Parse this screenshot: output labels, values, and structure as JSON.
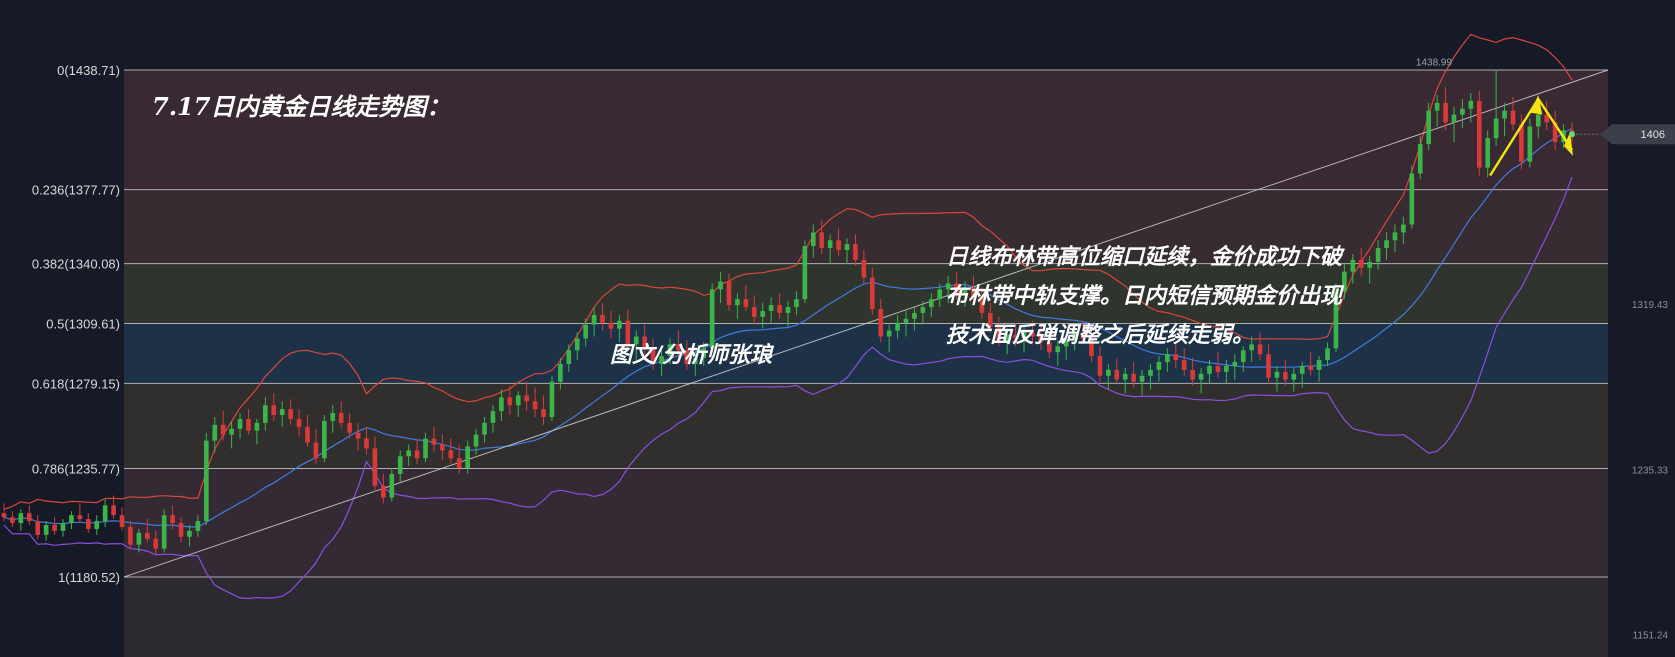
{
  "chart_data": {
    "type": "candlestick",
    "title": "7.17日内黄金日线走势图：",
    "author": "图文/分析师张琅",
    "annotation": [
      "日线布林带高位缩口延续，金价成功下破",
      "布林带中轨支撑。日内短信预期金价出现",
      "技术面反弹调整之后延续走弱。"
    ],
    "fib_levels": [
      {
        "ratio": "0",
        "price": 1438.71,
        "label": "0(1438.71)",
        "band_color": "#3b2a33"
      },
      {
        "ratio": "0.236",
        "price": 1377.77,
        "label": "0.236(1377.77)",
        "band_color": "#382d31"
      },
      {
        "ratio": "0.382",
        "price": 1340.08,
        "label": "0.382(1340.08)",
        "band_color": "#30362f"
      },
      {
        "ratio": "0.5",
        "price": 1309.61,
        "label": "0.5(1309.61)",
        "band_color": "#1e3349"
      },
      {
        "ratio": "0.618",
        "price": 1279.15,
        "label": "0.618(1279.15)",
        "band_color": "#33302d"
      },
      {
        "ratio": "0.786",
        "price": 1235.77,
        "label": "0.786(1235.77)",
        "band_color": "#362b35"
      },
      {
        "ratio": "1",
        "price": 1180.52,
        "label": "1(1180.52)",
        "band_color": "#2d2a31"
      }
    ],
    "price_axis_ticks": [
      "1319.43",
      "1235.33",
      "1151.24"
    ],
    "price_axis_ticks_values": [
      1319.43,
      1235.33,
      1151.24
    ],
    "high_label": "1438.99",
    "high_value": 1438.99,
    "current_price_label": "1406",
    "current_price": 1406,
    "candles": [
      [
        1213,
        1218,
        1209,
        1211
      ],
      [
        1211,
        1214,
        1206,
        1208
      ],
      [
        1208,
        1215,
        1204,
        1213
      ],
      [
        1213,
        1217,
        1207,
        1209
      ],
      [
        1209,
        1212,
        1200,
        1202
      ],
      [
        1202,
        1209,
        1199,
        1207
      ],
      [
        1207,
        1211,
        1202,
        1204
      ],
      [
        1204,
        1210,
        1201,
        1208
      ],
      [
        1208,
        1214,
        1205,
        1212
      ],
      [
        1212,
        1218,
        1208,
        1210
      ],
      [
        1210,
        1213,
        1203,
        1205
      ],
      [
        1205,
        1212,
        1202,
        1209
      ],
      [
        1209,
        1220,
        1206,
        1217
      ],
      [
        1217,
        1222,
        1210,
        1212
      ],
      [
        1212,
        1216,
        1204,
        1206
      ],
      [
        1206,
        1209,
        1195,
        1197
      ],
      [
        1197,
        1205,
        1193,
        1203
      ],
      [
        1203,
        1210,
        1198,
        1200
      ],
      [
        1200,
        1204,
        1192,
        1195
      ],
      [
        1195,
        1215,
        1193,
        1212
      ],
      [
        1212,
        1217,
        1205,
        1208
      ],
      [
        1208,
        1211,
        1198,
        1201
      ],
      [
        1201,
        1207,
        1196,
        1204
      ],
      [
        1204,
        1212,
        1201,
        1209
      ],
      [
        1209,
        1254,
        1207,
        1250
      ],
      [
        1250,
        1262,
        1244,
        1258
      ],
      [
        1258,
        1265,
        1250,
        1253
      ],
      [
        1253,
        1260,
        1246,
        1256
      ],
      [
        1256,
        1264,
        1251,
        1261
      ],
      [
        1261,
        1266,
        1253,
        1255
      ],
      [
        1255,
        1261,
        1248,
        1259
      ],
      [
        1259,
        1272,
        1255,
        1268
      ],
      [
        1268,
        1274,
        1260,
        1263
      ],
      [
        1263,
        1270,
        1257,
        1266
      ],
      [
        1266,
        1271,
        1258,
        1261
      ],
      [
        1261,
        1266,
        1252,
        1257
      ],
      [
        1257,
        1263,
        1247,
        1249
      ],
      [
        1249,
        1256,
        1238,
        1241
      ],
      [
        1241,
        1263,
        1239,
        1260
      ],
      [
        1260,
        1268,
        1254,
        1264
      ],
      [
        1264,
        1270,
        1256,
        1259
      ],
      [
        1259,
        1264,
        1251,
        1254
      ],
      [
        1254,
        1259,
        1245,
        1251
      ],
      [
        1251,
        1257,
        1243,
        1246
      ],
      [
        1246,
        1252,
        1224,
        1227
      ],
      [
        1227,
        1233,
        1218,
        1221
      ],
      [
        1221,
        1236,
        1219,
        1233
      ],
      [
        1233,
        1245,
        1229,
        1242
      ],
      [
        1242,
        1248,
        1237,
        1245
      ],
      [
        1245,
        1250,
        1238,
        1241
      ],
      [
        1241,
        1254,
        1239,
        1251
      ],
      [
        1251,
        1257,
        1244,
        1248
      ],
      [
        1248,
        1253,
        1240,
        1245
      ],
      [
        1245,
        1251,
        1238,
        1241
      ],
      [
        1241,
        1248,
        1233,
        1236
      ],
      [
        1236,
        1250,
        1233,
        1247
      ],
      [
        1247,
        1256,
        1243,
        1253
      ],
      [
        1253,
        1262,
        1249,
        1259
      ],
      [
        1259,
        1268,
        1254,
        1265
      ],
      [
        1265,
        1276,
        1260,
        1272
      ],
      [
        1272,
        1278,
        1263,
        1268
      ],
      [
        1268,
        1275,
        1262,
        1273
      ],
      [
        1273,
        1280,
        1265,
        1270
      ],
      [
        1270,
        1277,
        1262,
        1266
      ],
      [
        1266,
        1273,
        1258,
        1262
      ],
      [
        1262,
        1283,
        1260,
        1280
      ],
      [
        1280,
        1292,
        1276,
        1289
      ],
      [
        1289,
        1299,
        1285,
        1296
      ],
      [
        1296,
        1305,
        1291,
        1302
      ],
      [
        1302,
        1312,
        1298,
        1309
      ],
      [
        1309,
        1318,
        1303,
        1314
      ],
      [
        1314,
        1320,
        1306,
        1310
      ],
      [
        1310,
        1316,
        1302,
        1307
      ],
      [
        1307,
        1314,
        1300,
        1311
      ],
      [
        1311,
        1317,
        1296,
        1299
      ],
      [
        1299,
        1306,
        1291,
        1303
      ],
      [
        1303,
        1309,
        1294,
        1297
      ],
      [
        1297,
        1302,
        1286,
        1289
      ],
      [
        1289,
        1296,
        1283,
        1293
      ],
      [
        1293,
        1302,
        1289,
        1299
      ],
      [
        1299,
        1306,
        1292,
        1296
      ],
      [
        1296,
        1301,
        1286,
        1289
      ],
      [
        1289,
        1295,
        1283,
        1292
      ],
      [
        1292,
        1300,
        1288,
        1297
      ],
      [
        1297,
        1330,
        1295,
        1327
      ],
      [
        1327,
        1336,
        1320,
        1331
      ],
      [
        1331,
        1335,
        1316,
        1319
      ],
      [
        1319,
        1325,
        1312,
        1322
      ],
      [
        1322,
        1329,
        1316,
        1318
      ],
      [
        1318,
        1324,
        1309,
        1313
      ],
      [
        1313,
        1320,
        1307,
        1316
      ],
      [
        1316,
        1323,
        1310,
        1319
      ],
      [
        1319,
        1325,
        1312,
        1315
      ],
      [
        1315,
        1321,
        1308,
        1318
      ],
      [
        1318,
        1326,
        1314,
        1322
      ],
      [
        1322,
        1352,
        1320,
        1349
      ],
      [
        1349,
        1360,
        1343,
        1356
      ],
      [
        1356,
        1362,
        1345,
        1348
      ],
      [
        1348,
        1355,
        1340,
        1352
      ],
      [
        1352,
        1358,
        1344,
        1347
      ],
      [
        1347,
        1353,
        1340,
        1350
      ],
      [
        1350,
        1355,
        1339,
        1342
      ],
      [
        1342,
        1347,
        1330,
        1333
      ],
      [
        1333,
        1338,
        1314,
        1317
      ],
      [
        1317,
        1322,
        1300,
        1303
      ],
      [
        1303,
        1309,
        1295,
        1306
      ],
      [
        1306,
        1314,
        1302,
        1310
      ],
      [
        1310,
        1316,
        1303,
        1312
      ],
      [
        1312,
        1318,
        1306,
        1315
      ],
      [
        1315,
        1321,
        1309,
        1318
      ],
      [
        1318,
        1325,
        1313,
        1322
      ],
      [
        1322,
        1330,
        1318,
        1327
      ],
      [
        1327,
        1334,
        1320,
        1330
      ],
      [
        1330,
        1336,
        1322,
        1325
      ],
      [
        1325,
        1331,
        1318,
        1328
      ],
      [
        1328,
        1334,
        1320,
        1323
      ],
      [
        1323,
        1328,
        1312,
        1315
      ],
      [
        1315,
        1320,
        1305,
        1308
      ],
      [
        1308,
        1313,
        1298,
        1301
      ],
      [
        1301,
        1307,
        1294,
        1304
      ],
      [
        1304,
        1310,
        1298,
        1302
      ],
      [
        1302,
        1308,
        1295,
        1305
      ],
      [
        1305,
        1311,
        1299,
        1303
      ],
      [
        1303,
        1308,
        1296,
        1300
      ],
      [
        1300,
        1306,
        1292,
        1295
      ],
      [
        1295,
        1301,
        1288,
        1298
      ],
      [
        1298,
        1304,
        1291,
        1301
      ],
      [
        1301,
        1308,
        1296,
        1305
      ],
      [
        1305,
        1311,
        1299,
        1302
      ],
      [
        1302,
        1307,
        1290,
        1293
      ],
      [
        1293,
        1298,
        1280,
        1283
      ],
      [
        1283,
        1289,
        1276,
        1286
      ],
      [
        1286,
        1292,
        1279,
        1281
      ],
      [
        1281,
        1287,
        1274,
        1284
      ],
      [
        1284,
        1290,
        1277,
        1280
      ],
      [
        1280,
        1286,
        1273,
        1283
      ],
      [
        1283,
        1289,
        1276,
        1286
      ],
      [
        1286,
        1293,
        1280,
        1290
      ],
      [
        1290,
        1297,
        1285,
        1294
      ],
      [
        1294,
        1300,
        1287,
        1291
      ],
      [
        1291,
        1297,
        1283,
        1286
      ],
      [
        1286,
        1292,
        1278,
        1281
      ],
      [
        1281,
        1287,
        1274,
        1284
      ],
      [
        1284,
        1291,
        1279,
        1288
      ],
      [
        1288,
        1295,
        1282,
        1285
      ],
      [
        1285,
        1291,
        1279,
        1288
      ],
      [
        1288,
        1294,
        1281,
        1290
      ],
      [
        1290,
        1298,
        1285,
        1296
      ],
      [
        1296,
        1303,
        1290,
        1299
      ],
      [
        1299,
        1305,
        1291,
        1294
      ],
      [
        1294,
        1299,
        1279,
        1282
      ],
      [
        1282,
        1288,
        1275,
        1285
      ],
      [
        1285,
        1291,
        1278,
        1281
      ],
      [
        1281,
        1287,
        1275,
        1284
      ],
      [
        1284,
        1290,
        1277,
        1288
      ],
      [
        1288,
        1295,
        1283,
        1286
      ],
      [
        1286,
        1293,
        1280,
        1291
      ],
      [
        1291,
        1300,
        1288,
        1297
      ],
      [
        1297,
        1330,
        1295,
        1326
      ],
      [
        1326,
        1340,
        1322,
        1336
      ],
      [
        1336,
        1345,
        1330,
        1342
      ],
      [
        1342,
        1348,
        1334,
        1338
      ],
      [
        1338,
        1344,
        1330,
        1341
      ],
      [
        1341,
        1352,
        1337,
        1348
      ],
      [
        1348,
        1356,
        1342,
        1352
      ],
      [
        1352,
        1360,
        1346,
        1356
      ],
      [
        1356,
        1364,
        1350,
        1360
      ],
      [
        1360,
        1390,
        1358,
        1386
      ],
      [
        1386,
        1405,
        1383,
        1401
      ],
      [
        1401,
        1422,
        1398,
        1418
      ],
      [
        1418,
        1426,
        1410,
        1422
      ],
      [
        1422,
        1430,
        1408,
        1412
      ],
      [
        1412,
        1420,
        1402,
        1416
      ],
      [
        1416,
        1424,
        1409,
        1419
      ],
      [
        1419,
        1427,
        1412,
        1423
      ],
      [
        1423,
        1428,
        1385,
        1389
      ],
      [
        1389,
        1408,
        1384,
        1404
      ],
      [
        1404,
        1438.99,
        1400,
        1414
      ],
      [
        1414,
        1422,
        1405,
        1418
      ],
      [
        1418,
        1425,
        1408,
        1411
      ],
      [
        1411,
        1416,
        1388,
        1392
      ],
      [
        1392,
        1414,
        1389,
        1410
      ],
      [
        1410,
        1420,
        1404,
        1416
      ],
      [
        1416,
        1423,
        1408,
        1412
      ],
      [
        1412,
        1418,
        1398,
        1402
      ],
      [
        1402,
        1411,
        1399,
        1408
      ],
      [
        1408,
        1412,
        1402,
        1406
      ]
    ]
  }
}
